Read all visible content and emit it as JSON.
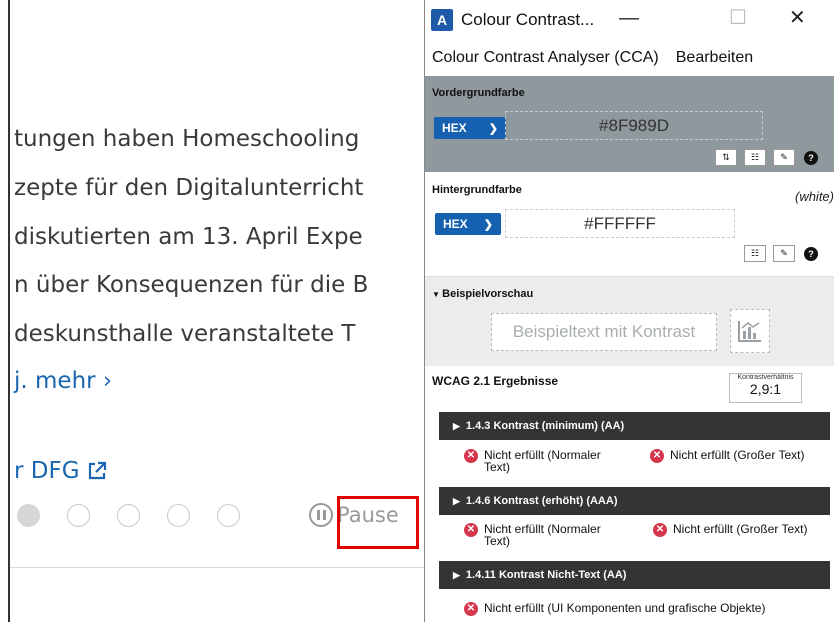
{
  "webpage": {
    "lines": [
      "tungen haben Homeschooling",
      "zepte für den Digitalunterricht",
      "diskutierten am 13. April Expe",
      "n über Konsequenzen für die B",
      "deskunsthalle veranstaltete T"
    ],
    "more_link": "j. mehr  ›",
    "dfg_link": "r DFG",
    "pause_label": "Pause",
    "slider_dot_count": 5,
    "active_dot_index": 0,
    "colors": {
      "link": "#1a66b0",
      "highlight": "#e00000"
    }
  },
  "cca": {
    "title": "Colour Contrast...",
    "app_icon": "cca-logo-icon",
    "window_controls": {
      "minimize": "—",
      "maximize": "☐",
      "close": "✕"
    },
    "menu": [
      "Colour Contrast Analyser (CCA)",
      "Bearbeiten"
    ],
    "foreground": {
      "label": "Vordergrundfarbe",
      "format": "HEX",
      "value": "#8F989D",
      "color": "#8F989D",
      "tools": [
        "swap-icon",
        "sliders-icon",
        "eyedropper-icon",
        "help-icon"
      ]
    },
    "background": {
      "label": "Hintergrundfarbe",
      "hint": "(white)",
      "format": "HEX",
      "value": "#FFFFFF",
      "color": "#FFFFFF",
      "tools": [
        "sliders-icon",
        "eyedropper-icon",
        "help-icon"
      ]
    },
    "preview": {
      "label": "Beispielvorschau",
      "sample_text": "Beispieltext mit Kontrast"
    },
    "results": {
      "title": "WCAG 2.1 Ergebnisse",
      "ratio_label": "Kontrastverhältnis",
      "ratio_value": "2,9:1",
      "criteria": [
        {
          "title": "1.4.3 Kontrast (minimum) (AA)",
          "results": [
            "Nicht erfüllt (Normaler Text)",
            "Nicht erfüllt (Großer Text)"
          ]
        },
        {
          "title": "1.4.6 Kontrast (erhöht) (AAA)",
          "results": [
            "Nicht erfüllt (Normaler Text)",
            "Nicht erfüllt (Großer Text)"
          ]
        },
        {
          "title": "1.4.11 Kontrast Nicht-Text (AA)",
          "results": [
            "Nicht erfüllt (UI Komponenten und grafische Objekte)"
          ]
        }
      ],
      "fail_color": "#d4374c"
    }
  }
}
